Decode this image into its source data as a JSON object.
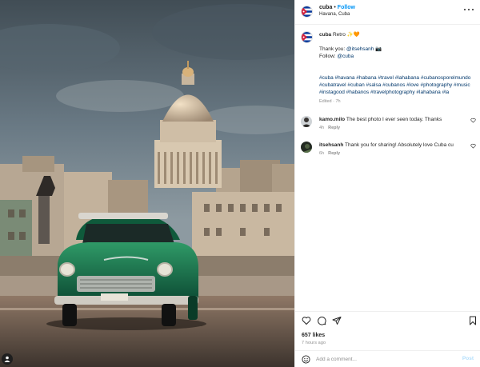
{
  "post": {
    "username": "cuba",
    "separator": "•",
    "follow_label": "Follow",
    "location": "Havana, Cuba",
    "colors": {
      "follow": "#0095f6",
      "link": "#00376b",
      "muted": "#8e8e8e"
    }
  },
  "caption": {
    "username": "cuba",
    "text": " Retro ✨🧡",
    "thanks_prefix": "Thank you: ",
    "thanks_handle": "@itsehsanh",
    "thanks_emoji": " 📷",
    "follow_prefix": "Follow: ",
    "follow_handle": "@cuba",
    "hashtags": "#cuba #havana #habana #travel #lahabana #cubanosporelmundo #cubatravel #cuban #salsa #cubanos #love #photography #music #instagood #habanos #travelphotography #lahabana #la",
    "edited": "Edited · 7h"
  },
  "comments": [
    {
      "username": "kamo.milo",
      "text": " The best photo I ever seen today. Thanks",
      "time": "4h",
      "reply_label": "Reply"
    },
    {
      "username": "itsehsanh",
      "text": " Thank you for sharing! Absolutely love Cuba cu",
      "time": "6h",
      "reply_label": "Reply"
    }
  ],
  "actions": {
    "icons": [
      "heart-icon",
      "comment-icon",
      "share-icon",
      "bookmark-icon"
    ],
    "likes": "657 likes",
    "posted": "7 hours ago"
  },
  "composer": {
    "placeholder": "Add a comment...",
    "post_label": "Post"
  }
}
